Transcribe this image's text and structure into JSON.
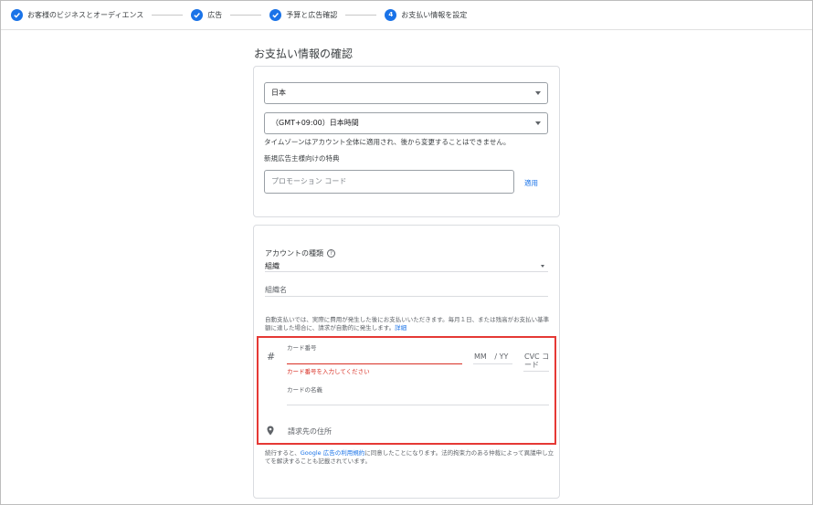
{
  "stepper": {
    "steps": [
      {
        "label": "お客様のビジネスとオーディエンス",
        "state": "done"
      },
      {
        "label": "広告",
        "state": "done"
      },
      {
        "label": "予算と広告確認",
        "state": "done"
      },
      {
        "label": "お支払い情報を設定",
        "state": "current",
        "number": "4"
      }
    ]
  },
  "page": {
    "title": "お支払い情報の確認"
  },
  "billing": {
    "country": "日本",
    "timezone": "（GMT+09:00）日本時間",
    "timezone_note": "タイムゾーンはアカウント全体に適用され、後から変更することはできません。",
    "promo_heading": "新規広告主様向けの特典",
    "promo_placeholder": "プロモーション コード",
    "apply_label": "適用"
  },
  "account": {
    "type_label": "アカウントの種類",
    "help_icon": "?",
    "type_value": "組織",
    "org_name_label": "組織名",
    "auto_pay_text": "自動支払いでは、実際に費用が発生した後にお支払いいただきます。毎月１日、または残高がお支払い基準額に達した場合に、請求が自動的に発生します。",
    "auto_pay_link": "詳細",
    "card_number_label": "カード番号",
    "card_number_error": "カード番号を入力してください",
    "expiry_mm": "MM",
    "expiry_sep": "/",
    "expiry_yy": "YY",
    "cvc_line1": "CVC コ",
    "cvc_line2": "ード",
    "cardholder_label": "カードの名義",
    "billing_address_label": "請求先の住所",
    "card_icon": "#",
    "terms_prefix": "続行すると、",
    "terms_link": "Google 広告の利用規約",
    "terms_suffix": "に同意したことになります。法的拘束力のある仲裁によって異議申し立てを解決することも記載されています。"
  },
  "colors": {
    "accent": "#1a73e8",
    "error": "#d93025",
    "highlight": "#e53935"
  }
}
